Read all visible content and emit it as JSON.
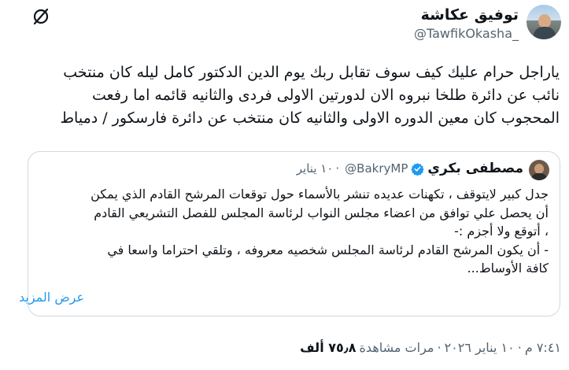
{
  "author": {
    "display_name": "توفيق عكاشة",
    "handle": "@TawfikOkasha_",
    "avatar_icon": "profile-photo"
  },
  "header_icon": "grok-icon",
  "tweet": {
    "lines": [
      "ياراجل حرام عليك كيف سوف تقابل ربك يوم الدين الدكتور كامل ليله كان منتخب",
      "نائب عن دائرة طلخا نبروه الان لدورتين الاولى فردى والثانيه قائمه اما رفعت",
      "المحجوب كان معين الدوره الاولى والثانيه كان منتخب عن دائرة فارسكور / دمياط"
    ]
  },
  "quote": {
    "display_name": "مصطفى بكري",
    "handle": "@BakryMP",
    "separator": "·",
    "date": "١٠ يناير",
    "verified_icon": "verified-badge-icon",
    "lines": [
      "جدل كبير لايتوقف ، تكهنات عديده تنشر بالأسماء حول توقعات المرشح القادم الذي يمكن",
      "أن يحصل علي توافق من اعضاء مجلس النواب لرئاسة المجلس للفصل التشريعي القادم",
      "، أتوقع ولا أجزم :-",
      "- أن يكون المرشح القادم لرئاسة المجلس شخصيه معروفه ، وتلقي احتراما واسعا في",
      "كافة الأوساط..."
    ],
    "show_more": "عرض المزيد"
  },
  "meta": {
    "time": "٧:٤١ م",
    "sep1": "·",
    "date": "١٠ يناير ٢٠٢٦",
    "sep2": "·",
    "views_count": "٧٥٫٨ ألف",
    "views_label": "مرات مشاهدة"
  },
  "colors": {
    "text": "#0f1419",
    "secondary": "#536471",
    "link": "#1d9bf0",
    "border": "#cfd9de",
    "verified": "#1d9bf0"
  }
}
